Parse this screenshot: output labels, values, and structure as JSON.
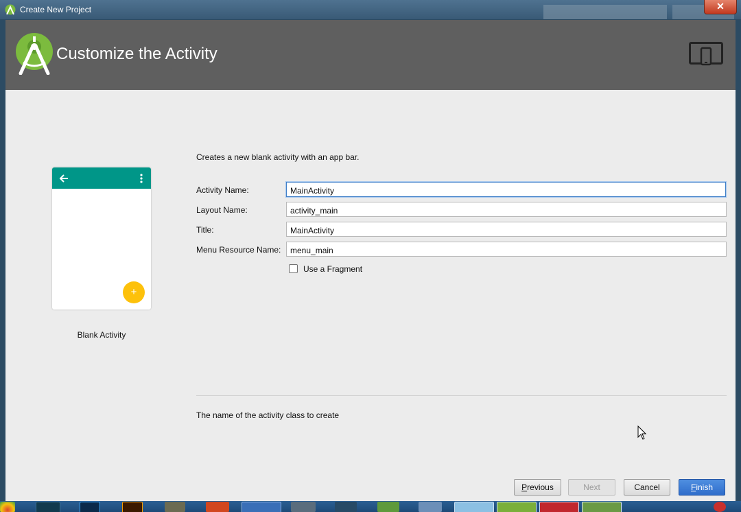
{
  "window": {
    "title": "Create New Project",
    "close_label": "✕"
  },
  "header": {
    "title": "Customize the Activity"
  },
  "template": {
    "name": "Blank Activity",
    "fab_label": "+",
    "appbar_color": "#009688",
    "fab_color": "#fdc10b"
  },
  "description": "Creates a new blank activity with an app bar.",
  "form": {
    "activity_name": {
      "label": "Activity Name:",
      "value": "MainActivity"
    },
    "layout_name": {
      "label": "Layout Name:",
      "value": "activity_main"
    },
    "title": {
      "label": "Title:",
      "value": "MainActivity"
    },
    "menu_resource_name": {
      "label": "Menu Resource Name:",
      "value": "menu_main"
    },
    "use_fragment": {
      "label": "Use a Fragment",
      "checked": false
    }
  },
  "hint": "The name of the activity class to create",
  "buttons": {
    "previous": {
      "underlined": "P",
      "rest": "revious"
    },
    "next": "Next",
    "cancel": "Cancel",
    "finish": {
      "underlined": "F",
      "rest": "inish"
    }
  },
  "taskbar": {
    "items": [
      "chrome-icon",
      "filmora-icon",
      "photoshop-icon",
      "illustrator-icon",
      "gimp-icon",
      "powerpoint-icon",
      "word-icon",
      "settings-icon",
      "steam-icon",
      "android-studio-icon",
      "virtualbox-icon",
      "photos-icon",
      "folder-icon",
      "acrobat-icon",
      "android-studio-active-icon"
    ]
  },
  "colors": {
    "header_bg": "#5f5f5f",
    "accent": "#3f7fc8",
    "finish_button": "#2f6dcb"
  }
}
